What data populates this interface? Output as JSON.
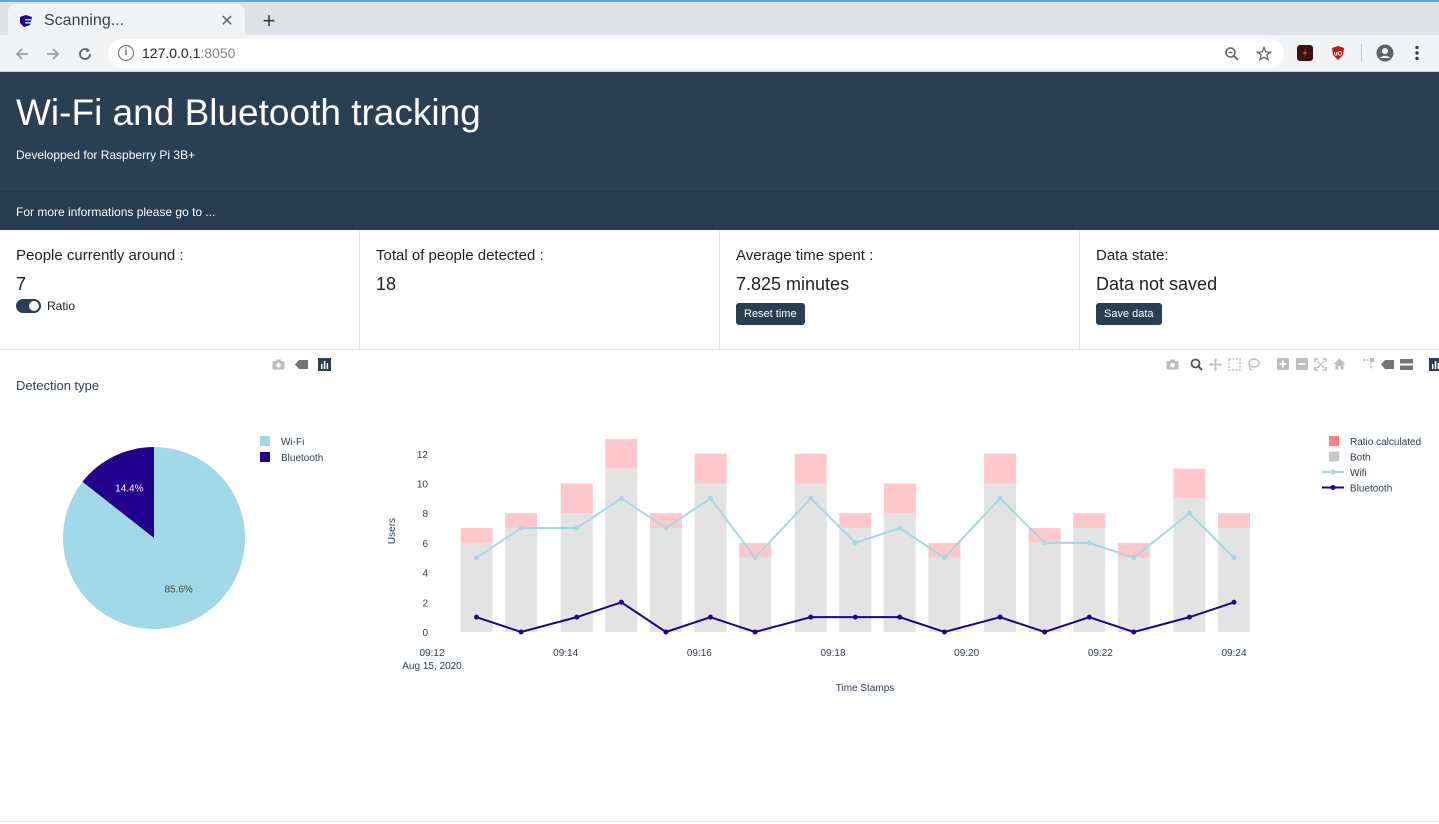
{
  "browser": {
    "tab_title": "Scanning...",
    "url_host": "127.0.0.1",
    "url_port": ":8050"
  },
  "header": {
    "title": "Wi-Fi and Bluetooth tracking",
    "subtitle": "Developped for Raspberry Pi 3B+",
    "info": "For more informations please go to ..."
  },
  "cards": {
    "people_around": {
      "label": "People currently around :",
      "value": "7",
      "toggle_label": "Ratio",
      "toggle_on": true
    },
    "total_detected": {
      "label": "Total of people detected :",
      "value": "18"
    },
    "avg_time": {
      "label": "Average time spent :",
      "value": "7.825 minutes",
      "button": "Reset time"
    },
    "data_state": {
      "label": "Data state:",
      "value": "Data not saved",
      "button": "Save data"
    }
  },
  "pie_section": {
    "title": "Detection type"
  },
  "colors": {
    "header_bg": "#2a3f54",
    "wifi": "#a2d9e8",
    "bluetooth": "#23018c",
    "both": "#e3e3e3",
    "ratio": "#ffc8cc",
    "ratio_legend": "#ff7f83"
  },
  "chart_data": [
    {
      "type": "pie",
      "title": "Detection type",
      "labels": [
        "Wi-Fi",
        "Bluetooth"
      ],
      "values": [
        85.6,
        14.4
      ],
      "value_labels": [
        "85.6%",
        "14.4%"
      ],
      "colors": [
        "#a2d9e8",
        "#23018c"
      ],
      "legend": "top-right"
    },
    {
      "type": "bar",
      "xlabel": "Time Stamps",
      "ylabel": "Users",
      "x_ticks": [
        "09:12",
        "09:14",
        "09:16",
        "09:18",
        "09:20",
        "09:22",
        "09:24"
      ],
      "x_tick_sub": "Aug 15, 2020",
      "y_ticks": [
        0,
        2,
        4,
        6,
        8,
        10,
        12
      ],
      "ylim": [
        0,
        13.6
      ],
      "barmode": "stack",
      "legend": "top-right",
      "times": [
        "09:12:40",
        "09:13:20",
        "09:14:10",
        "09:14:50",
        "09:15:30",
        "09:16:10",
        "09:16:50",
        "09:17:40",
        "09:18:20",
        "09:19:00",
        "09:19:40",
        "09:20:30",
        "09:21:10",
        "09:21:50",
        "09:22:30",
        "09:23:20",
        "09:24:00"
      ],
      "series": [
        {
          "name": "Ratio calculated",
          "kind": "bar",
          "color": "#ffc8cc",
          "legend_color": "#ff7f83",
          "values": [
            1,
            1,
            2,
            2,
            1,
            2,
            1,
            2,
            1,
            2,
            1,
            2,
            1,
            1,
            1,
            2,
            1
          ]
        },
        {
          "name": "Both",
          "kind": "bar",
          "color": "#e3e3e3",
          "legend_color": "#c8c8c8",
          "values": [
            6,
            7,
            8,
            11,
            7,
            10,
            5,
            10,
            7,
            8,
            5,
            10,
            6,
            7,
            5,
            9,
            7
          ]
        },
        {
          "name": "Wifi",
          "kind": "line",
          "color": "#a2d9e8",
          "values": [
            5,
            7,
            7,
            9,
            7,
            9,
            5,
            9,
            6,
            7,
            5,
            9,
            6,
            6,
            5,
            8,
            5
          ]
        },
        {
          "name": "Bluetooth",
          "kind": "line",
          "color": "#23018c",
          "values": [
            1,
            0,
            1,
            2,
            0,
            1,
            0,
            1,
            1,
            1,
            0,
            1,
            0,
            1,
            0,
            1,
            2
          ]
        }
      ]
    }
  ]
}
